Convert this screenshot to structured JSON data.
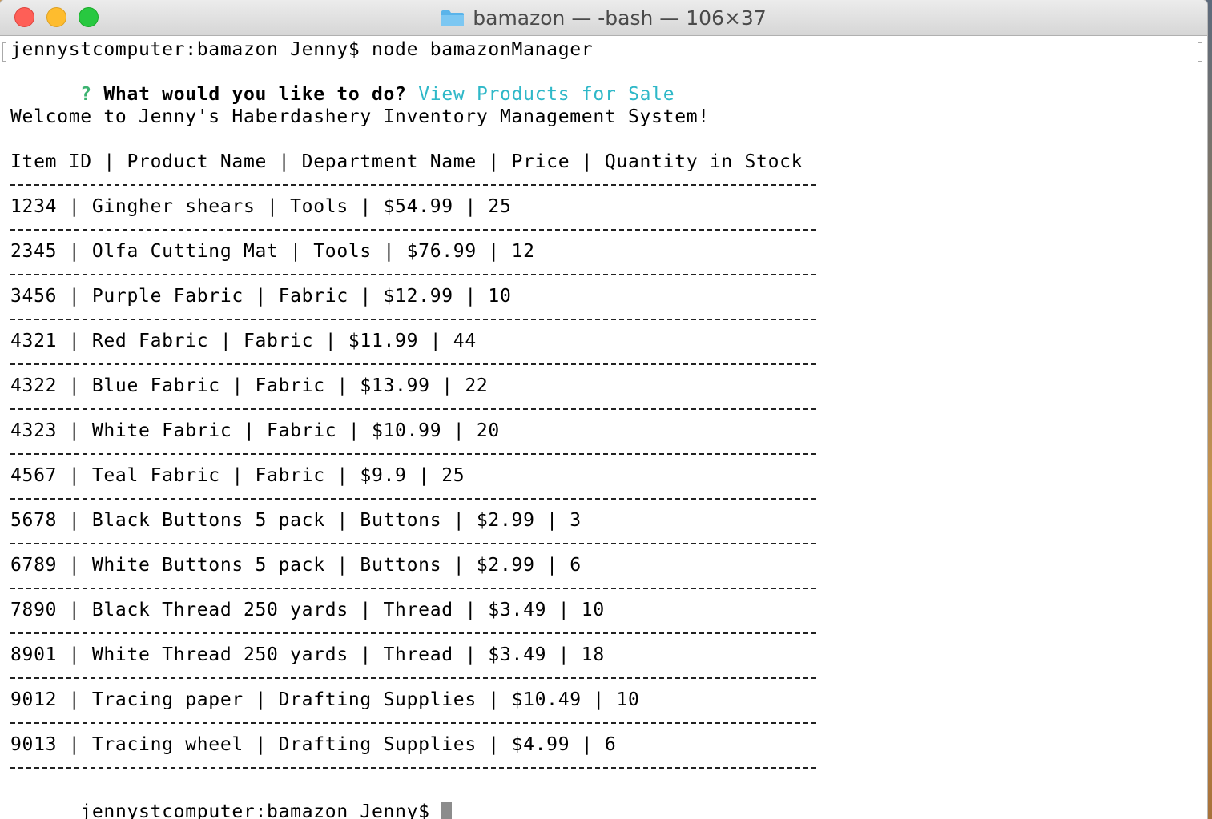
{
  "window": {
    "title": "bamazon — -bash — 106×37",
    "folder_icon": "folder-icon"
  },
  "terminal": {
    "command_line": "jennystcomputer:bamazon Jenny$ node bamazonManager",
    "prompt": {
      "marker": "?",
      "question": "What would you like to do?",
      "answer": "View Products for Sale"
    },
    "welcome": "Welcome to Jenny's Haberdashery Inventory Management System!",
    "header": "Item ID | Product Name | Department Name | Price | Quantity in Stock",
    "rows": [
      "1234 | Gingher shears | Tools | $54.99 | 25",
      "2345 | Olfa Cutting Mat | Tools | $76.99 | 12",
      "3456 | Purple Fabric | Fabric | $12.99 | 10",
      "4321 | Red Fabric | Fabric | $11.99 | 44",
      "4322 | Blue Fabric | Fabric | $13.99 | 22",
      "4323 | White Fabric | Fabric | $10.99 | 20",
      "4567 | Teal Fabric | Fabric | $9.9 | 25",
      "5678 | Black Buttons 5 pack | Buttons | $2.99 | 3",
      "6789 | White Buttons 5 pack | Buttons | $2.99 | 6",
      "7890 | Black Thread 250 yards | Thread | $3.49 | 10",
      "8901 | White Thread 250 yards | Thread | $3.49 | 18",
      "9012 | Tracing paper | Drafting Supplies | $10.49 | 10",
      "9013 | Tracing wheel | Drafting Supplies | $4.99 | 6"
    ],
    "final_prompt": "jennystcomputer:bamazon Jenny$"
  },
  "colors": {
    "prompt_marker": "#3cb371",
    "answer": "#2fb8c8",
    "close": "#fe5f57",
    "minimize": "#febc2e",
    "zoom": "#28c840"
  }
}
